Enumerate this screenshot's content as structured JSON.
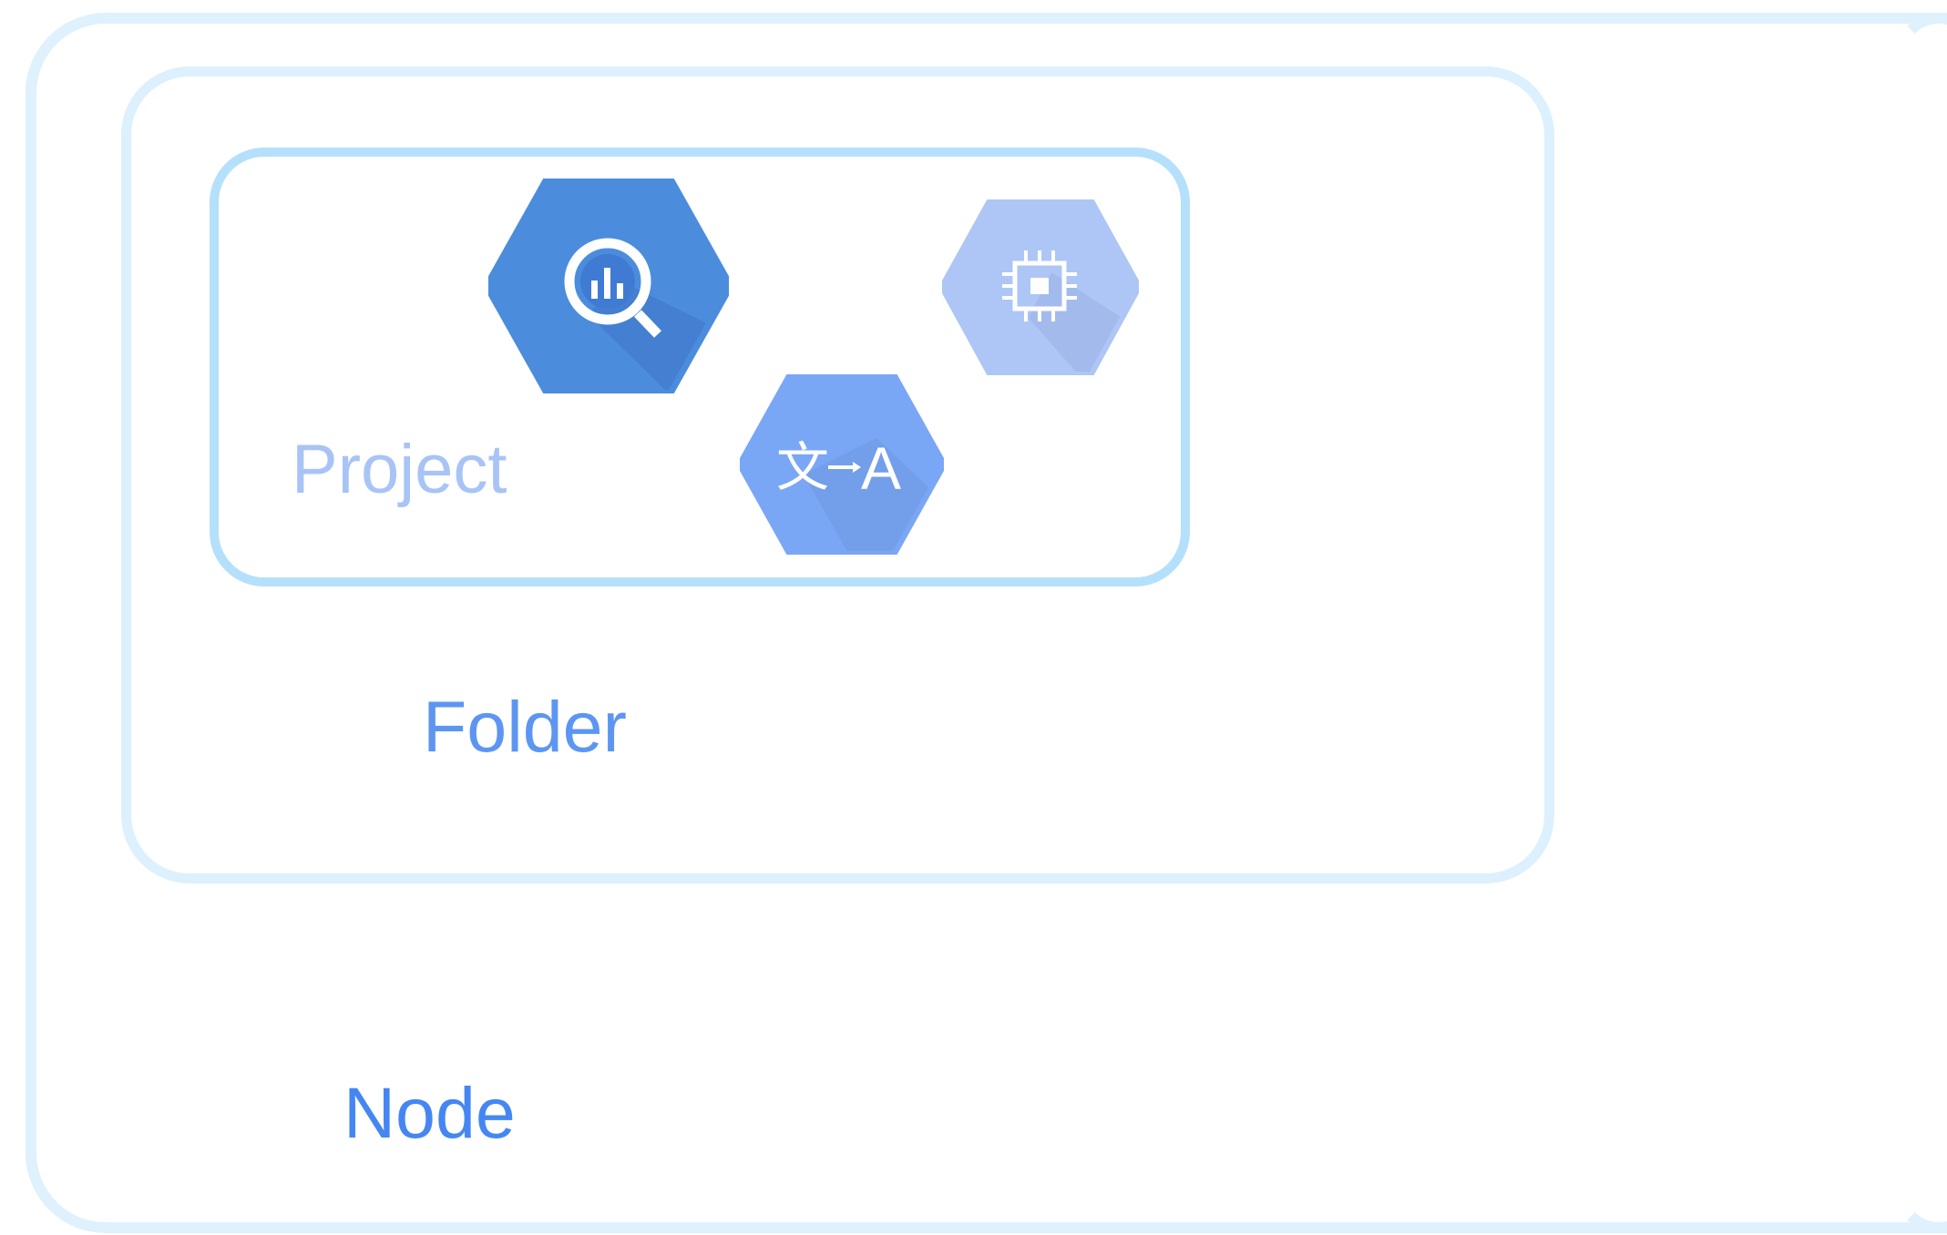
{
  "labels": {
    "node": "Node",
    "folder": "Folder",
    "project": "Project"
  },
  "colors": {
    "node_border": "#def1fd",
    "folder_border": "#dcf0fd",
    "project_border": "#b5e0fb",
    "node_text": "#4587f2",
    "folder_text": "#5c96f2",
    "project_text": "#a8c4f7",
    "bigquery_fill": "#4b8ddc",
    "compute_fill": "#aec6f5",
    "translate_fill": "#7aa7f5"
  },
  "icons": {
    "bigquery": "bigquery-icon",
    "compute": "compute-engine-chip-icon",
    "translate": "translation-icon"
  }
}
